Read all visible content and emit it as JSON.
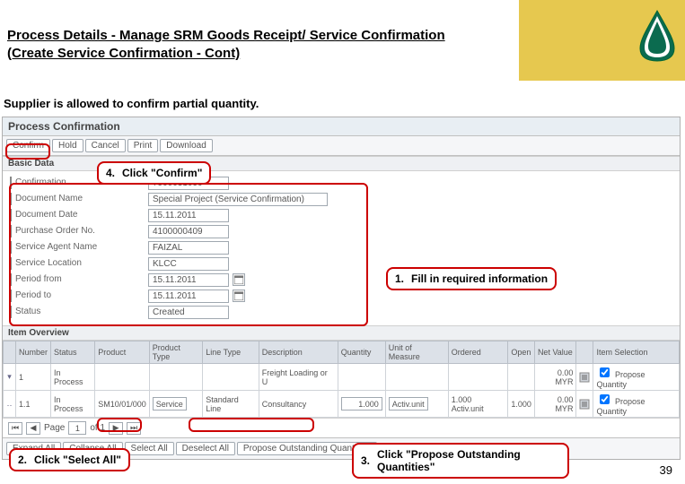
{
  "slide": {
    "title": "Process Details - Manage SRM Goods Receipt/ Service Confirmation (Create Service Confirmation - Cont)",
    "subtitle": "Supplier is allowed to confirm partial quantity.",
    "page_number": "39"
  },
  "sap": {
    "screen_title": "Process Confirmation",
    "toolbar": {
      "confirm": "Confirm",
      "hold": "Hold",
      "cancel": "Cancel",
      "print": "Print",
      "download": "Download"
    },
    "sections": {
      "basic": "Basic Data",
      "items": "Item Overview"
    },
    "form": {
      "confirmation_label": "Confirmation",
      "confirmation": "7900031090",
      "doc_name_label": "Document Name",
      "doc_name": "Special Project (Service Confirmation)",
      "doc_date_label": "Document Date",
      "doc_date": "15.11.2011",
      "po_label": "Purchase Order No.",
      "po": "4100000409",
      "agent_label": "Service Agent Name",
      "agent": "FAIZAL",
      "loc_label": "Service Location",
      "loc": "KLCC",
      "from_label": "Period from",
      "from": "15.11.2011",
      "to_label": "Period to",
      "to": "15.11.2011",
      "status_label": "Status",
      "status": "Created"
    },
    "table": {
      "hdr": {
        "number": "Number",
        "status": "Status",
        "product": "Product",
        "ptype": "Product Type",
        "ltype": "Line Type",
        "desc": "Description",
        "qty": "Quantity",
        "uom": "Unit of Measure",
        "ordered": "Ordered",
        "open": "Open",
        "net": "Net Value",
        "sel": "Item Selection"
      },
      "rows": [
        {
          "num": "1",
          "status": "In Process",
          "product": "",
          "ptype": "",
          "ltype": "",
          "desc": "Freight Loading or U",
          "qty": "",
          "uom": "",
          "ordered": "",
          "open": "",
          "net": "0.00 MYR",
          "sel_label": "Propose Quantity",
          "sel_checked": true
        },
        {
          "num": "1.1",
          "status": "In Process",
          "product": "SM10/01/000",
          "ptype": "Service",
          "ltype": "Standard Line",
          "desc": "Consultancy",
          "qty": "1.000",
          "uom": "Activ.unit",
          "ordered": "1.000 Activ.unit",
          "open": "1.000",
          "net": "0.00 MYR",
          "sel_label": "Propose Quantity",
          "sel_checked": true
        }
      ]
    },
    "pager": {
      "page_label": "Page",
      "page": "1",
      "of": "of 1"
    },
    "bottom": {
      "expand": "Expand All",
      "collapse": "Collapse All",
      "select": "Select All",
      "deselect": "Deselect All",
      "propose": "Propose Outstanding Quantities"
    }
  },
  "callouts": {
    "c1": {
      "num": "1.",
      "text": "Fill in required information"
    },
    "c2": {
      "num": "2.",
      "text": "Click \"Select All\""
    },
    "c3": {
      "num": "3.",
      "text": "Click \"Propose Outstanding Quantities\""
    },
    "c4": {
      "num": "4.",
      "text": "Click \"Confirm\""
    }
  }
}
